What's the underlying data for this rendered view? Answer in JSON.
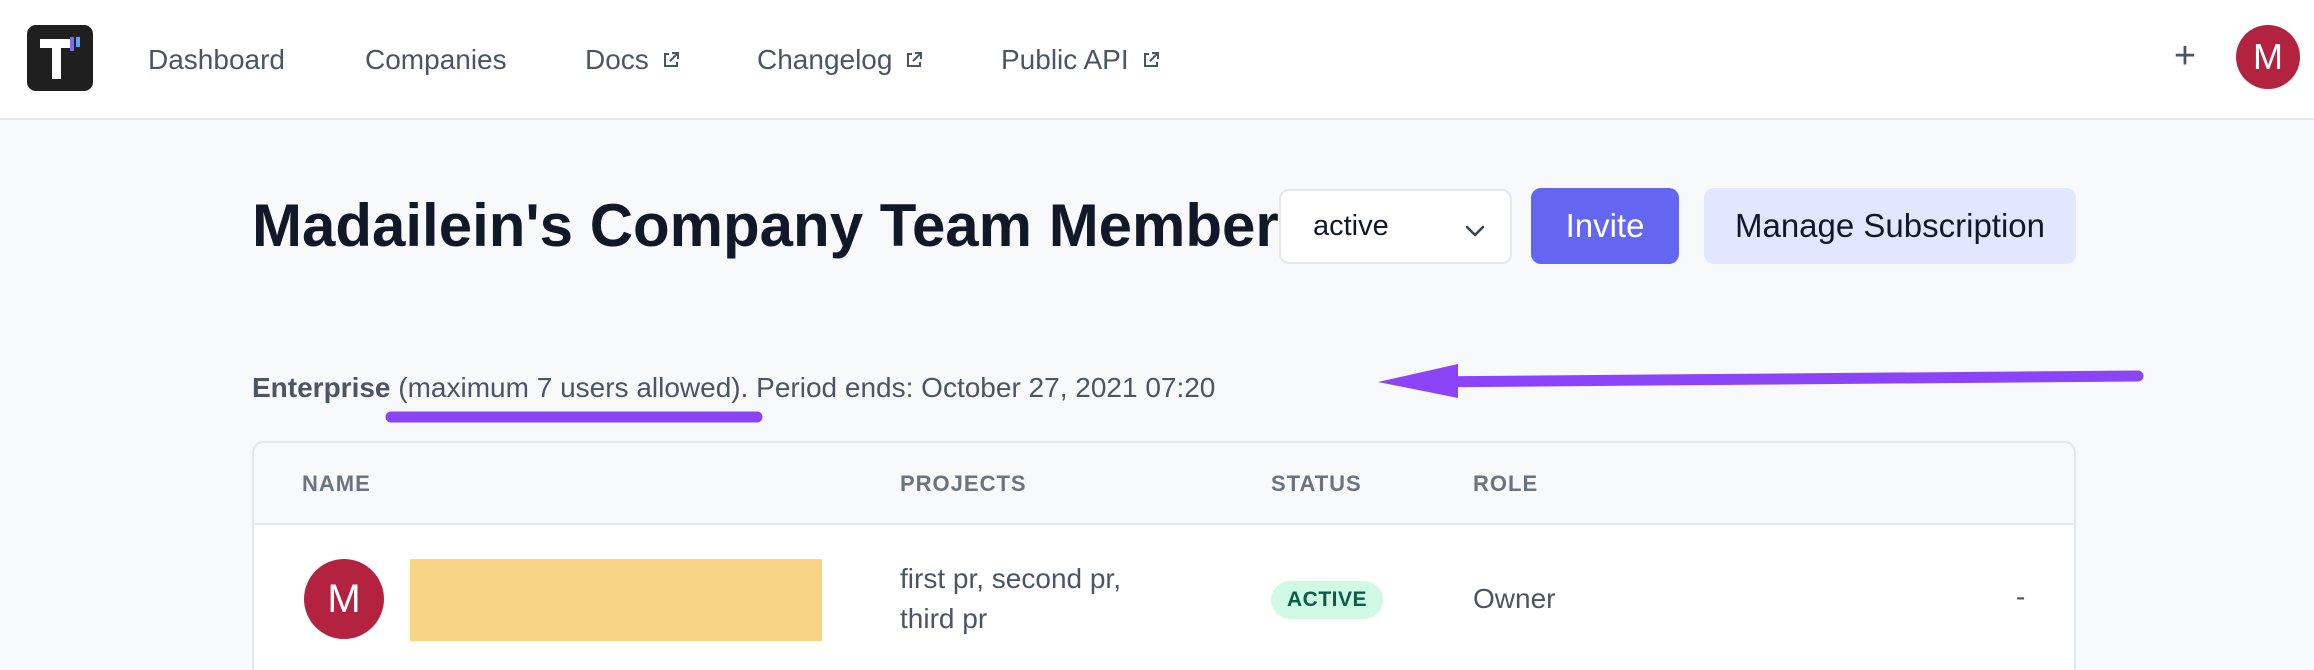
{
  "nav": {
    "links": [
      {
        "label": "Dashboard",
        "external": false
      },
      {
        "label": "Companies",
        "external": false
      },
      {
        "label": "Docs",
        "external": true
      },
      {
        "label": "Changelog",
        "external": true
      },
      {
        "label": "Public API",
        "external": true
      }
    ],
    "plus_label": "+",
    "avatar_initial": "M"
  },
  "header": {
    "title": "Madailein's Company Team Members",
    "status_filter": {
      "selected": "active"
    },
    "invite_label": "Invite",
    "manage_label": "Manage Subscription"
  },
  "plan": {
    "name": "Enterprise",
    "limit_text": "(maximum 7 users allowed).",
    "period_text": "Period ends: October 27, 2021 07:20"
  },
  "table": {
    "columns": [
      "NAME",
      "PROJECTS",
      "STATUS",
      "ROLE"
    ],
    "rows": [
      {
        "avatar_initial": "M",
        "projects_line1": "first pr, second pr,",
        "projects_line2": "third pr",
        "status": "ACTIVE",
        "role": "Owner",
        "action": "-"
      }
    ]
  },
  "colors": {
    "accent": "#6366f1",
    "accent_light": "#e0e7ff",
    "avatar": "#b3233f",
    "annotation": "#8b44f7",
    "redaction": "#f9d485",
    "status_active_bg": "#d1fae5",
    "status_active_fg": "#065f46"
  },
  "icons": {
    "logo": "app-logo",
    "external": "external-link-icon",
    "chevron": "chevron-down-icon"
  }
}
